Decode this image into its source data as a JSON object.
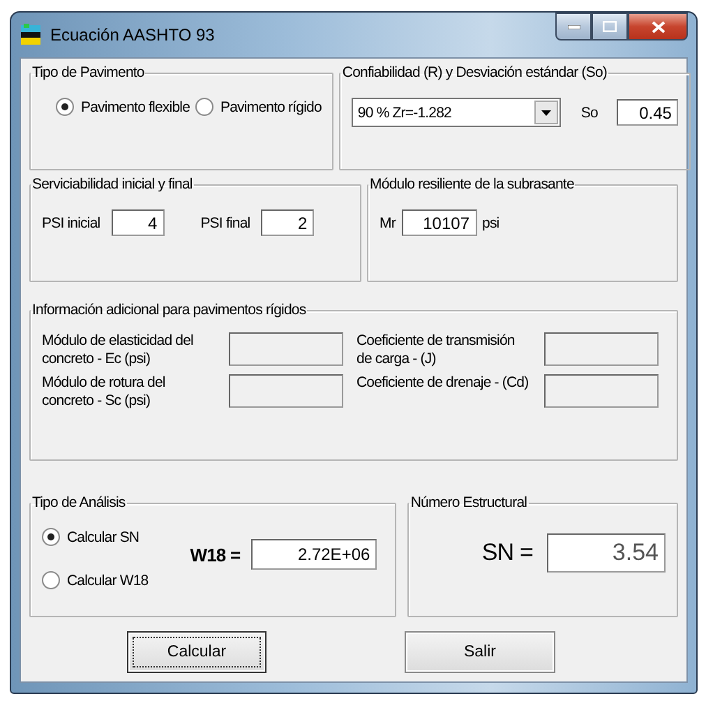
{
  "window": {
    "title": "Ecuación AASHTO 93"
  },
  "pavement_type": {
    "title": "Tipo de Pavimento",
    "options": [
      {
        "label": "Pavimento flexible",
        "selected": true
      },
      {
        "label": "Pavimento rígido",
        "selected": false
      }
    ]
  },
  "reliability": {
    "title": "Confiabilidad (R) y Desviación estándar (So)",
    "dropdown": "90 % Zr=-1.282",
    "so_label": "So",
    "so_value": "0.45"
  },
  "serviceability": {
    "title": "Serviciabilidad inicial y final",
    "fields": [
      {
        "label": "PSI inicial",
        "value": "4"
      },
      {
        "label": "PSI final",
        "value": "2"
      }
    ]
  },
  "subgrade": {
    "title": "Módulo resiliente de la subrasante",
    "label": "Mr",
    "value": "10107",
    "unit": "psi"
  },
  "rigid_info": {
    "title": "Información adicional para pavimentos rígidos",
    "fields": [
      {
        "label": "Módulo de elasticidad del concreto - Ec (psi)",
        "disabled": true
      },
      {
        "label": "Coeficiente de transmisión de carga - (J)",
        "disabled": true
      },
      {
        "label": "Módulo de rotura del concreto - Sc (psi)",
        "disabled": true
      },
      {
        "label": "Coeficiente de drenaje - (Cd)",
        "disabled": true
      }
    ]
  },
  "analysis": {
    "title": "Tipo de Análisis",
    "options": [
      {
        "label": "Calcular SN",
        "selected": true
      },
      {
        "label": "Calcular W18",
        "selected": false
      }
    ],
    "w18_label": "W18 =",
    "w18_value": "2.72E+06"
  },
  "structural_number": {
    "title": "Número Estructural",
    "label": "SN =",
    "value": "3.54"
  },
  "buttons": [
    {
      "label": "Calcular",
      "focused": true
    },
    {
      "label": "Salir",
      "focused": false
    }
  ]
}
